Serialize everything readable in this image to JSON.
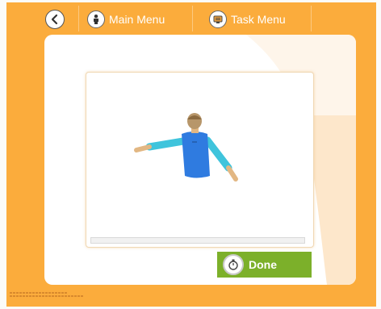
{
  "navbar": {
    "main_menu_label": "Main Menu",
    "task_menu_label": "Task Menu"
  },
  "actions": {
    "done_label": "Done"
  },
  "icons": {
    "back": "back-arrow-icon",
    "main_menu": "person-icon",
    "task_menu": "task-list-icon",
    "done": "stopwatch-icon"
  },
  "colors": {
    "frame": "#fbac3c",
    "done_button": "#7cb02a",
    "shirt": "#2f7be0",
    "sleeve": "#3fc4dc"
  }
}
